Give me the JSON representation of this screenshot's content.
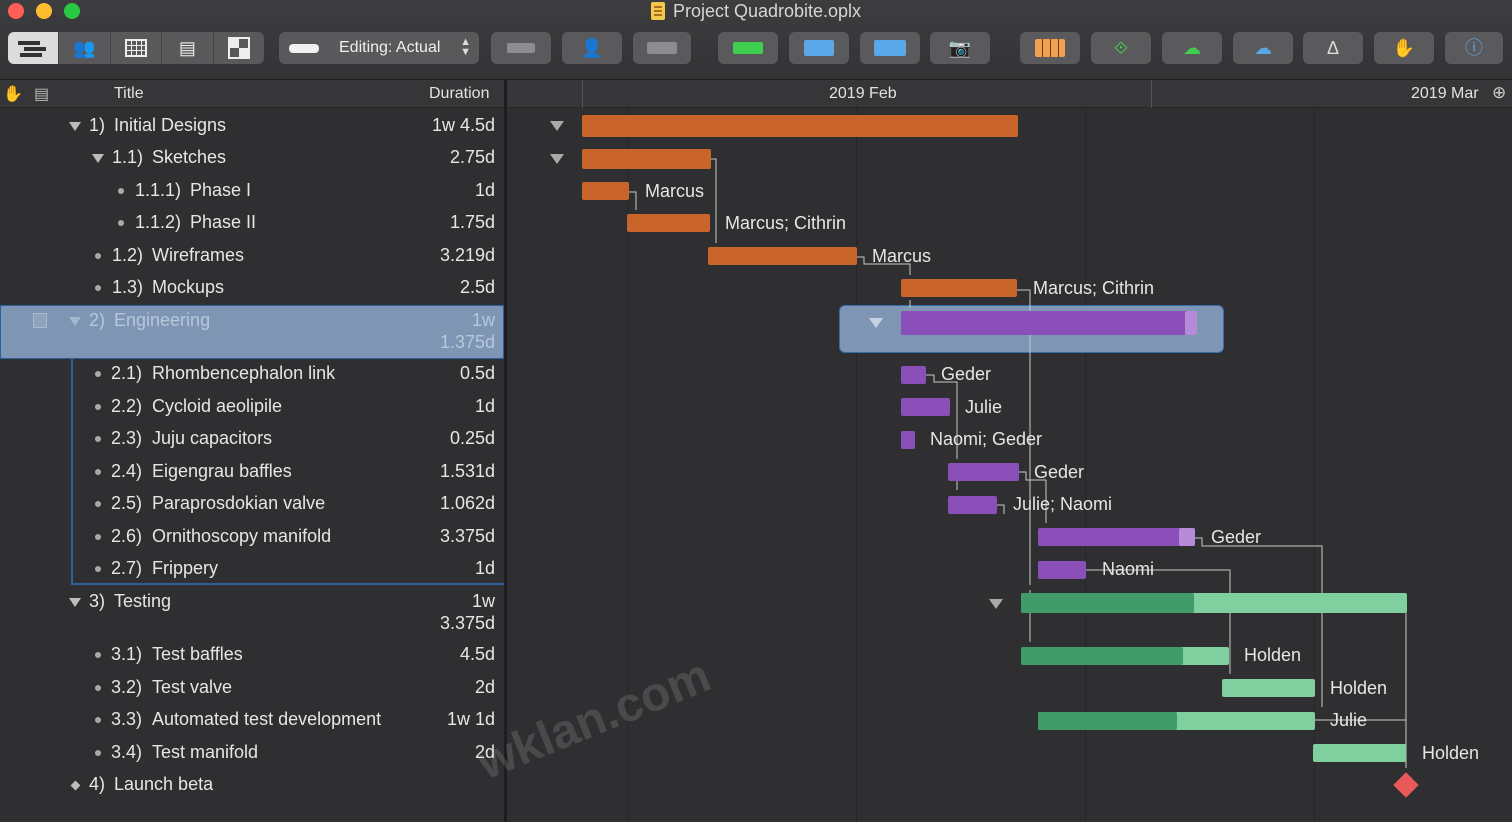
{
  "window": {
    "title": "Project Quadrobite.oplx"
  },
  "toolbar": {
    "editing_label": "Editing: Actual"
  },
  "outline": {
    "header_title": "Title",
    "header_duration": "Duration",
    "rows": [
      {
        "num": "1)",
        "title": "Initial Designs",
        "duration": "1w 4.5d"
      },
      {
        "num": "1.1)",
        "title": "Sketches",
        "duration": "2.75d"
      },
      {
        "num": "1.1.1)",
        "title": "Phase I",
        "duration": "1d"
      },
      {
        "num": "1.1.2)",
        "title": "Phase II",
        "duration": "1.75d"
      },
      {
        "num": "1.2)",
        "title": "Wireframes",
        "duration": "3.219d"
      },
      {
        "num": "1.3)",
        "title": "Mockups",
        "duration": "2.5d"
      },
      {
        "num": "2)",
        "title": "Engineering",
        "duration": "1w",
        "duration2": "1.375d"
      },
      {
        "num": "2.1)",
        "title": "Rhombencephalon link",
        "duration": "0.5d"
      },
      {
        "num": "2.2)",
        "title": "Cycloid aeolipile",
        "duration": "1d"
      },
      {
        "num": "2.3)",
        "title": "Juju capacitors",
        "duration": "0.25d"
      },
      {
        "num": "2.4)",
        "title": "Eigengrau baffles",
        "duration": "1.531d"
      },
      {
        "num": "2.5)",
        "title": "Paraprosdokian valve",
        "duration": "1.062d"
      },
      {
        "num": "2.6)",
        "title": "Ornithoscopy manifold",
        "duration": "3.375d"
      },
      {
        "num": "2.7)",
        "title": "Frippery",
        "duration": "1d"
      },
      {
        "num": "3)",
        "title": "Testing",
        "duration": "1w",
        "duration2": "3.375d"
      },
      {
        "num": "3.1)",
        "title": "Test baffles",
        "duration": "4.5d"
      },
      {
        "num": "3.2)",
        "title": "Test valve",
        "duration": "2d"
      },
      {
        "num": "3.3)",
        "title": "Automated test development",
        "duration": "1w 1d"
      },
      {
        "num": "3.4)",
        "title": "Test manifold",
        "duration": "2d"
      },
      {
        "num": "4)",
        "title": "Launch beta",
        "duration": ""
      }
    ]
  },
  "gantt": {
    "month_feb": "2019 Feb",
    "month_mar": "2019 Mar",
    "resources": {
      "phase1": "Marcus",
      "phase2": "Marcus; Cithrin",
      "wireframes": "Marcus",
      "mockups": "Marcus; Cithrin",
      "t21": "Geder",
      "t22": "Julie",
      "t23": "Naomi; Geder",
      "t24": "Geder",
      "t25": "Julie; Naomi",
      "t26": "Geder",
      "t27": "Naomi",
      "t31": "Holden",
      "t32": "Holden",
      "t33": "Julie",
      "t34": "Holden"
    },
    "colors": {
      "design": "#c9652a",
      "engineering": "#8a4fb8",
      "engineering_light": "#b58ad8",
      "testing_done": "#3f9c68",
      "testing_todo": "#7fcf9f",
      "milestone": "#e85a5a"
    }
  },
  "watermark": "wklan.com"
}
